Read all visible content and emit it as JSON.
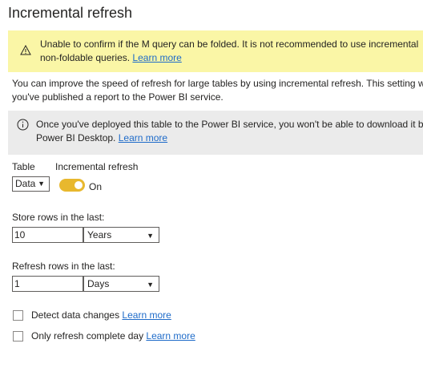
{
  "page": {
    "title": "Incremental refresh"
  },
  "warning": {
    "line1": "Unable to confirm if the M query can be folded. It is not recommended to use incremental",
    "line2": "non-foldable queries.",
    "link": "Learn more"
  },
  "description": {
    "line1": "You can improve the speed of refresh for large tables by using incremental refresh. This setting w",
    "line2": "you've published a report to the Power BI service."
  },
  "info": {
    "line1": "Once you've deployed this table to the Power BI service, you won't be able to download it b",
    "line2": "Power BI Desktop.",
    "link": "Learn more"
  },
  "table": {
    "label": "Table",
    "value": "Data"
  },
  "incremental": {
    "label": "Incremental refresh",
    "state": "On"
  },
  "store": {
    "label": "Store rows in the last:",
    "value": "10",
    "unit": "Years"
  },
  "refresh": {
    "label": "Refresh rows in the last:",
    "value": "1",
    "unit": "Days"
  },
  "detect": {
    "label": "Detect data changes",
    "link": "Learn more"
  },
  "complete": {
    "label": "Only refresh complete day",
    "link": "Learn more"
  },
  "colors": {
    "warning_bg": "#faf6a6",
    "info_bg": "#ebebeb",
    "toggle_on": "#e8b82e",
    "link": "#1e6bc9"
  }
}
